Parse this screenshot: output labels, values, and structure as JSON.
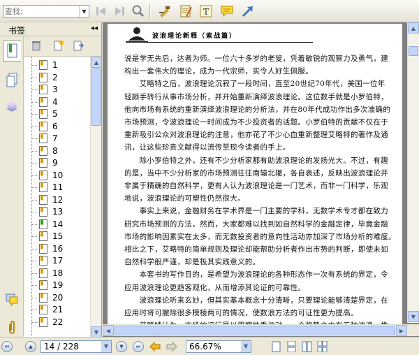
{
  "toolbar": {
    "search_placeholder": "查找:",
    "buttons": [
      "previous-result-icon",
      "next-result-icon",
      "find-icon",
      "select-text-icon",
      "note-icon",
      "text-tool-icon",
      "comment-icon",
      "arrow-tool-icon"
    ]
  },
  "left_panel": {
    "title": "书签",
    "collapse_glyph": "◂◂",
    "tabs": [
      "bookmarks-tab-icon",
      "pages-tab-icon",
      "layers-tab-icon",
      "comments-tab-icon",
      "attachments-tab-icon"
    ]
  },
  "bookmarks": [
    "1",
    "2",
    "3",
    "4",
    "5",
    "6",
    "7",
    "8",
    "9",
    "10",
    "11",
    "12",
    "13",
    "14",
    "15",
    "16",
    "17",
    "18",
    "19",
    "20",
    "21",
    "22"
  ],
  "document": {
    "header": "波浪理论新释（索战篇）",
    "lines": [
      "说是学无先后，达者为师。一位六十多岁的老叟，凭着敏锐的观察力及勇气，建",
      "构出一套伟大的理论，成为一代宗师，实令人好生佩服。",
      "　　艾略特之后，波浪理论沉寂了一段时间，直至20世纪70年代，美国一位年",
      "轻颇手转行从事市场分析，并开始重新演绎波浪理论。这位数手就是小罗伯特，",
      "他向市场有系统的重新演绎波浪理论的分析法，并在80年代成功作出多次准确的",
      "市场预测，令波浪理论一时间成为不少投资者的话题。小罗伯特的贡献不仅在于",
      "重新吸引公众对波浪理论的注意，他亦花了不少心血重新整理艾略特的著作及通",
      "讯，让这些珍贵文献得以流传至现今读者的手上。",
      "　　除小罗伯特之外，还有不少分析家都有助波浪理论的发扬光大。不过，有趣",
      "的是，当中不少分析家的市场预测往往南辕北辙，各自表述，反映出波浪理论并",
      "非属于精确的自然科学，更有人认为波浪理论是一门艺术，而非一门科学，乐观",
      "地说，波浪理论的可塑性仍然很大。",
      "　　事实上来说，金融财务在学术界是一门主要的学科，无数学术专才都在致力",
      "研究市场预测的方法，然而，大家都难以找到如自然科学的金融定律，毕竟金融",
      "市场的影响因素实在太多，而无数投资者的意向性活动亦加深了市场分析的难度。",
      "相比之下，艾略特的简单规则及理论却能帮助分析者作出市势的判断，即使未如",
      "自然科学般严谨，却是极其实践意义的。",
      "　　本套书的写作目的，是希望为波浪理论的各种形态作一次有系统的界定，令",
      "应用波浪理论更趋客观化，从而增添其论证的可靠性。",
      "　　波浪理论听来玄妙，但其实基本概念十分清晰，只要理论能够清楚界定，在",
      "应用时将可撇除很多模棱两可的情况，使数浪方法的可证性更为提高。",
      "　　艾略特认为，市场的运行是以周期性重波动，一个趋势之中有五种波浪，推"
    ]
  },
  "statusbar": {
    "page": "14 / 228",
    "zoom": "66.67%",
    "nav_buttons": [
      "first-page-icon",
      "previous-page-icon",
      "next-page-icon",
      "last-page-icon",
      "back-icon",
      "forward-icon"
    ],
    "view_buttons": [
      "single-page-icon",
      "continuous-icon",
      "facing-icon",
      "continuous-facing-icon"
    ]
  },
  "colors": {
    "chrome": "#ece9d8",
    "doc_background": "#808080",
    "scroll_thumb": "#c2d3fc",
    "field_border": "#7f9db9"
  }
}
